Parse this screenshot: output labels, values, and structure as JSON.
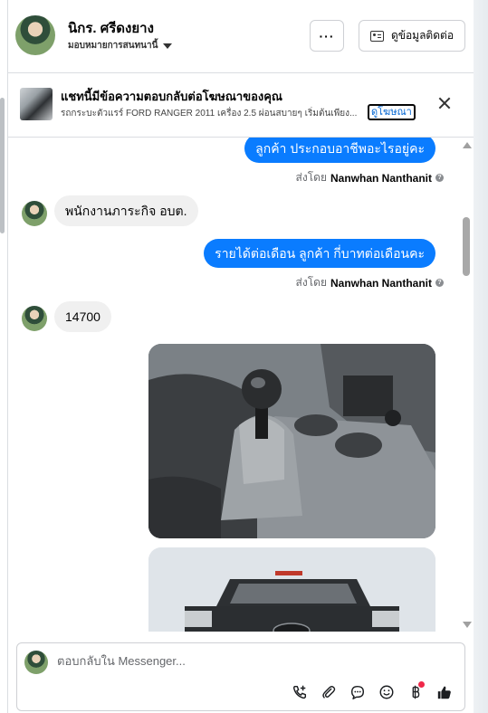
{
  "header": {
    "name": "นิกร. ศรีดงยาง",
    "assign_label": "มอบหมายการสนทนานี้",
    "more_label": "···",
    "contact_button": "ดูข้อมูลติดต่อ"
  },
  "ad": {
    "title": "แชทนี้มีข้อความตอบกลับต่อโฆษณาของคุณ",
    "description": "รถกระบะตัวแรร์ FORD RANGER 2011 เครื่อง 2.5 ผ่อนสบายๆ เริ่มต้นเพียง...",
    "link": "ดูโฆษณา"
  },
  "messages": {
    "out1": "ลูกค้า ประกอบอาชีพอะไรอยู่คะ",
    "sent_by_prefix": "ส่งโดย",
    "sender": "Nanwhan Nanthanit",
    "in1": "พนักงานภาระกิจ อบต.",
    "out2": "รายได้ต่อเดือน ลูกค้า กี่บาทต่อเดือนคะ",
    "in2": "14700"
  },
  "composer": {
    "placeholder": "ตอบกลับใน Messenger..."
  },
  "icons": [
    "chevron-down-icon",
    "contact-card-icon",
    "close-icon",
    "info-icon",
    "add-call-icon",
    "attachment-icon",
    "saved-reply-icon",
    "emoji-icon",
    "payment-icon",
    "like-icon"
  ],
  "colors": {
    "accent": "#0a7cff",
    "incoming_bubble": "#f0f0f0",
    "notification": "#f02849"
  }
}
